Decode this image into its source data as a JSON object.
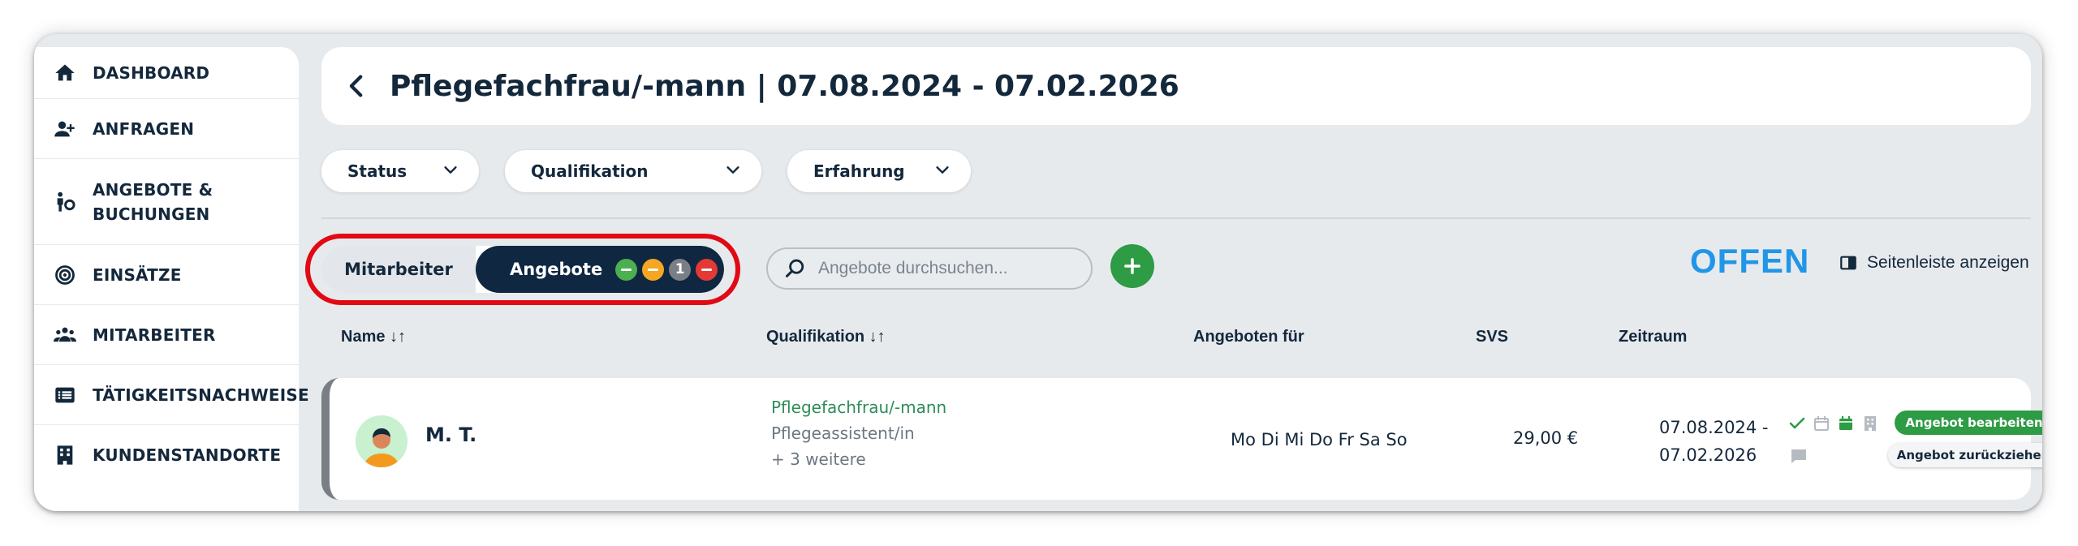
{
  "sidebar": {
    "items": [
      {
        "label": "DASHBOARD",
        "icon": "home-icon"
      },
      {
        "label": "ANFRAGEN",
        "icon": "add-person-icon"
      },
      {
        "label": "ANGEBOTE & BUCHUNGEN",
        "icon": "person-offer-icon"
      },
      {
        "label": "EINSÄTZE",
        "icon": "target-icon"
      },
      {
        "label": "MITARBEITER",
        "icon": "group-icon"
      },
      {
        "label": "TÄTIGKEITSNACHWEISE",
        "icon": "list-icon"
      },
      {
        "label": "KUNDENSTANDORTE",
        "icon": "building-icon"
      }
    ]
  },
  "header": {
    "title": "Pflegefachfrau/-mann | 07.08.2024 - 07.02.2026"
  },
  "filters": [
    {
      "label": "Status"
    },
    {
      "label": "Qualifikation"
    },
    {
      "label": "Erfahrung"
    }
  ],
  "toggle": {
    "left_label": "Mitarbeiter",
    "right_label": "Angebote",
    "badges": [
      {
        "type": "dash",
        "color": "#4caf50"
      },
      {
        "type": "dash",
        "color": "#f5a623"
      },
      {
        "type": "count",
        "value": "1",
        "color": "#7a7f86"
      },
      {
        "type": "dash",
        "color": "#e53935"
      }
    ]
  },
  "search": {
    "placeholder": "Angebote durchsuchen..."
  },
  "status": "OFFEN",
  "sidebar_toggle_label": "Seitenleiste anzeigen",
  "table": {
    "headers": [
      "Name ↓↑",
      "Qualifikation ↓↑",
      "Angeboten für",
      "SVS",
      "Zeitraum"
    ],
    "rows": [
      {
        "name": "M. T.",
        "qualifications": [
          "Pflegefachfrau/-mann",
          "Pflegeassistent/in",
          "+ 3 weitere"
        ],
        "days": "Mo Di Mi Do Fr Sa So",
        "svs": "29,00 €",
        "period_start": "07.08.2024 -",
        "period_end": "07.02.2026",
        "edit_label": "Angebot bearbeiten",
        "withdraw_label": "Angebot zurückziehen"
      }
    ]
  },
  "colors": {
    "brand_dark": "#0f2740",
    "accent_blue": "#2196e8",
    "green": "#2e9b45",
    "highlight_red": "#e00914"
  }
}
